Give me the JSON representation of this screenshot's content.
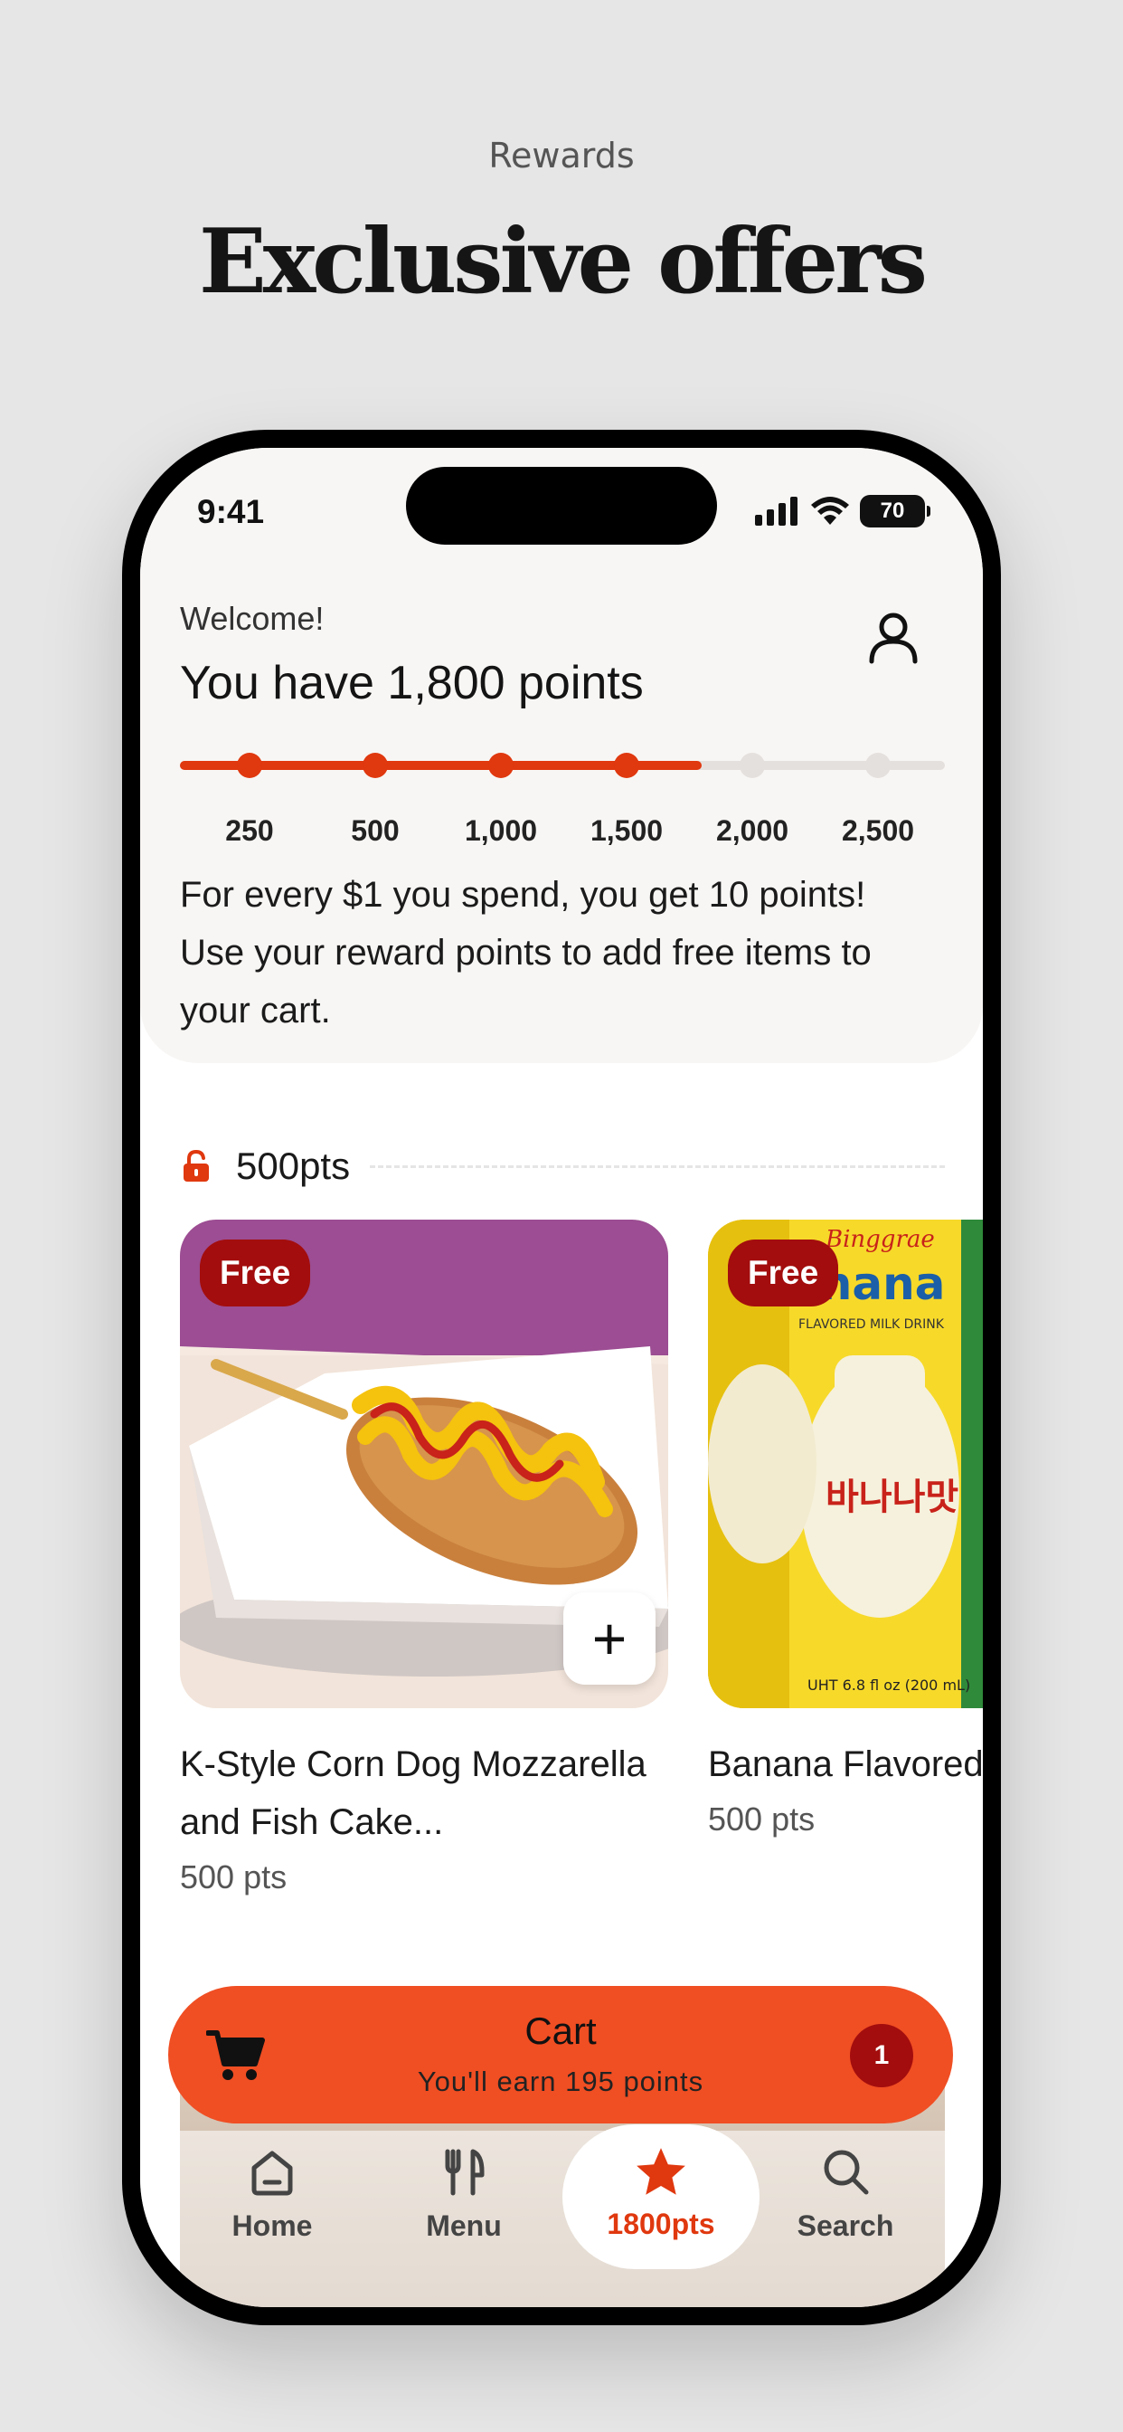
{
  "hero": {
    "subtitle": "Rewards",
    "title": "Exclusive offers"
  },
  "status_bar": {
    "time": "9:41",
    "battery": "70"
  },
  "header": {
    "welcome": "Welcome!",
    "points_title": "You have 1,800 points",
    "profile_icon": "person-icon"
  },
  "progress": {
    "current_points": 1800,
    "max_points": 2500,
    "milestones": [
      "250",
      "500",
      "1,000",
      "1,500",
      "2,000",
      "2,500"
    ],
    "milestone_values": [
      250,
      500,
      1000,
      1500,
      2000,
      2500
    ]
  },
  "earn_info": "For every $1 you spend, you get 10 points! Use your reward points to add free items to your cart.",
  "section": {
    "label": "500pts",
    "icon": "unlock-icon"
  },
  "cards": [
    {
      "badge": "Free",
      "name": "K-Style Corn Dog Mozzarella and Fish Cake...",
      "points": "500 pts",
      "has_add": true,
      "add_label": "+"
    },
    {
      "badge": "Free",
      "name": "Banana Flavored",
      "points": "500 pts",
      "has_add": false
    }
  ],
  "cart": {
    "title": "Cart",
    "subtitle": "You'll earn 195 points",
    "count": "1",
    "icon": "cart-icon"
  },
  "nav": {
    "items": [
      {
        "label": "Home",
        "icon": "home-icon"
      },
      {
        "label": "Menu",
        "icon": "utensils-icon"
      },
      {
        "label": "1800pts",
        "icon": "star-icon",
        "active": true
      },
      {
        "label": "Search",
        "icon": "search-icon"
      }
    ]
  },
  "colors": {
    "accent": "#f04e23",
    "accent_dark": "#e0380f",
    "badge": "#a30d0d",
    "background": "#e6e6e6"
  }
}
